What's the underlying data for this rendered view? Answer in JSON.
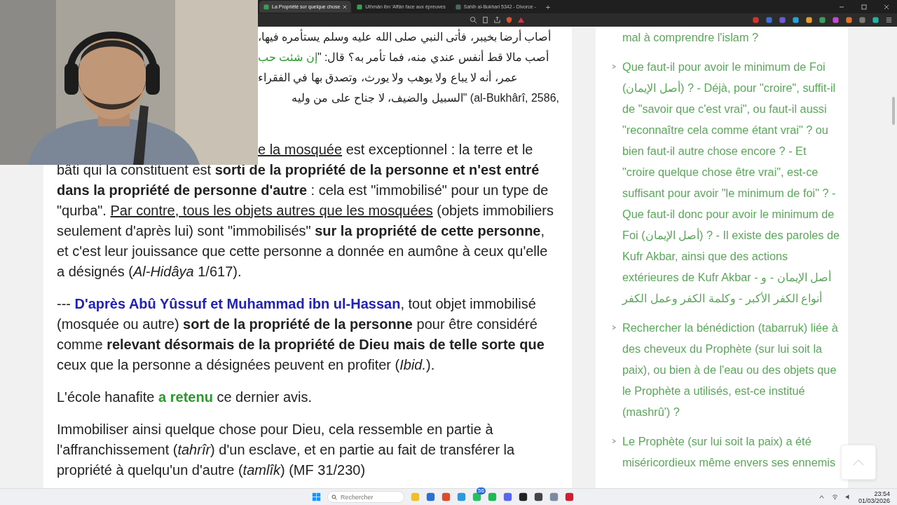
{
  "browser": {
    "tabs": [
      {
        "title": "La Propriété sur quelque chose",
        "selected": true
      },
      {
        "title": "Uthmân ibn 'Affân face aux épreuves",
        "selected": false
      },
      {
        "title": "Sahih al-Bukhari 5342 - Divorce -",
        "selected": false
      }
    ],
    "new_tab": "+"
  },
  "article": {
    "arabic_lines": [
      {
        "kind": "arabic",
        "parts": [
          {
            "kind": "plain",
            "text": "أصاب أرضا بخيبر، فأتى النبي صلى الله عليه وسلم يستأمره فيها،"
          }
        ]
      },
      {
        "kind": "arabic",
        "parts": [
          {
            "kind": "plain",
            "text": "أصب مالا قط أنفس عندي منه، فما تأمر به؟ قال: \""
          },
          {
            "kind": "green",
            "text": "إن شئت حب"
          }
        ]
      },
      {
        "kind": "arabic",
        "parts": [
          {
            "kind": "plain",
            "text": "عمر، أنه لا يباع ولا يوهب ولا يورث، وتصدق بها في الفقراء"
          }
        ]
      },
      {
        "kind": "mixed",
        "parts": [
          {
            "kind": "plain",
            "text": "\"السبيل والضيف، لا جناح على من وليه"
          },
          {
            "kind": "plain",
            "text": " (al-Bukhârî, 2586,"
          }
        ]
      }
    ],
    "paragraphs": [
      {
        "kind": "indented",
        "parts": [
          {
            "kind": "underline",
            "text": "e la mosquée"
          },
          {
            "kind": "plain",
            "text": " est exceptionnel : la terre et le bâti qui la constituent est "
          },
          {
            "kind": "bold",
            "text": "sorti de la propriété de la personne et n'est entré dans la propriété de personne d'autre"
          },
          {
            "kind": "plain",
            "text": " : cela est \"immobilisé\" pour un type de \"qurba\". "
          },
          {
            "kind": "underline",
            "text": "Par contre, tous les objets autres que les mosquées"
          },
          {
            "kind": "plain",
            "text": " (objets immobiliers seulement d'après lui) sont \"immobilisés\" "
          },
          {
            "kind": "bold",
            "text": "sur la propriété de cette personne"
          },
          {
            "kind": "plain",
            "text": ", et c'est leur jouissance que cette personne a donnée en aumône à ceux qu'elle a désignés ("
          },
          {
            "kind": "italic",
            "text": "Al-Hidâya"
          },
          {
            "kind": "plain",
            "text": " 1/617)."
          }
        ]
      },
      {
        "kind": "normal",
        "parts": [
          {
            "kind": "plain",
            "text": "--- "
          },
          {
            "kind": "link",
            "text": "D'après Abû Yûssuf et Muhammad ibn ul-Hassan"
          },
          {
            "kind": "plain",
            "text": ", tout objet immobilisé (mosquée ou autre) "
          },
          {
            "kind": "bold",
            "text": "sort de la propriété de la personne"
          },
          {
            "kind": "plain",
            "text": " pour être considéré comme "
          },
          {
            "kind": "bold",
            "text": "relevant désormais de la propriété de Dieu mais de telle sorte que"
          },
          {
            "kind": "plain",
            "text": " ceux que la personne a désignées peuvent en profiter ("
          },
          {
            "kind": "italic",
            "text": "Ibid."
          },
          {
            "kind": "plain",
            "text": ")."
          }
        ]
      },
      {
        "kind": "normal",
        "parts": [
          {
            "kind": "plain",
            "text": "L'école hanafite "
          },
          {
            "kind": "green",
            "text": "a retenu"
          },
          {
            "kind": "plain",
            "text": " ce dernier avis."
          }
        ]
      },
      {
        "kind": "normal",
        "parts": [
          {
            "kind": "plain",
            "text": "Immobiliser ainsi quelque chose pour Dieu, cela ressemble en partie à l'affranchissement ("
          },
          {
            "kind": "italic",
            "text": "tahrîr"
          },
          {
            "kind": "plain",
            "text": ") d'un esclave, et en partie au fait de transférer la propriété à quelqu'un d'autre ("
          },
          {
            "kind": "italic",
            "text": "tamlîk"
          },
          {
            "kind": "plain",
            "text": ") (MF 31/230)"
          }
        ]
      }
    ]
  },
  "sidebar": {
    "items": [
      {
        "kind": "continuation",
        "text": "mal à comprendre l'islam ?"
      },
      {
        "kind": "item",
        "text": "Que faut-il pour avoir le minimum de Foi (أصل الإيمان) ? - Déjà, pour \"croire\", suffit-il de \"savoir que c'est vrai\", ou faut-il aussi \"reconnaître cela comme étant vrai\" ? ou bien faut-il autre chose encore ? - Et \"croire quelque chose être vrai\", est-ce suffisant pour avoir \"le minimum de foi\" ? - Que faut-il donc pour avoir le minimum de Foi (أصل الإيمان) ? - Il existe des paroles de Kufr Akbar, ainsi que des actions extérieures de Kufr Akbar - أصل الإيمان - و أنواع الكفر الأكبر - وكلمة الكفر وعمل الكفر"
      },
      {
        "kind": "item",
        "text": "Rechercher la bénédiction (tabarruk) liée à des cheveux du Prophète (sur lui soit la paix), ou bien à de l'eau ou des objets que le Prophète a utilisés, est-ce institué (mashrû') ?"
      },
      {
        "kind": "item",
        "text": "Le Prophète (sur lui soit la paix) a été miséricordieux même envers ses ennemis"
      }
    ]
  },
  "taskbar": {
    "search": {
      "placeholder": "Rechercher"
    },
    "badge": "56",
    "time": "23:54",
    "date": "01/03/2026"
  }
}
